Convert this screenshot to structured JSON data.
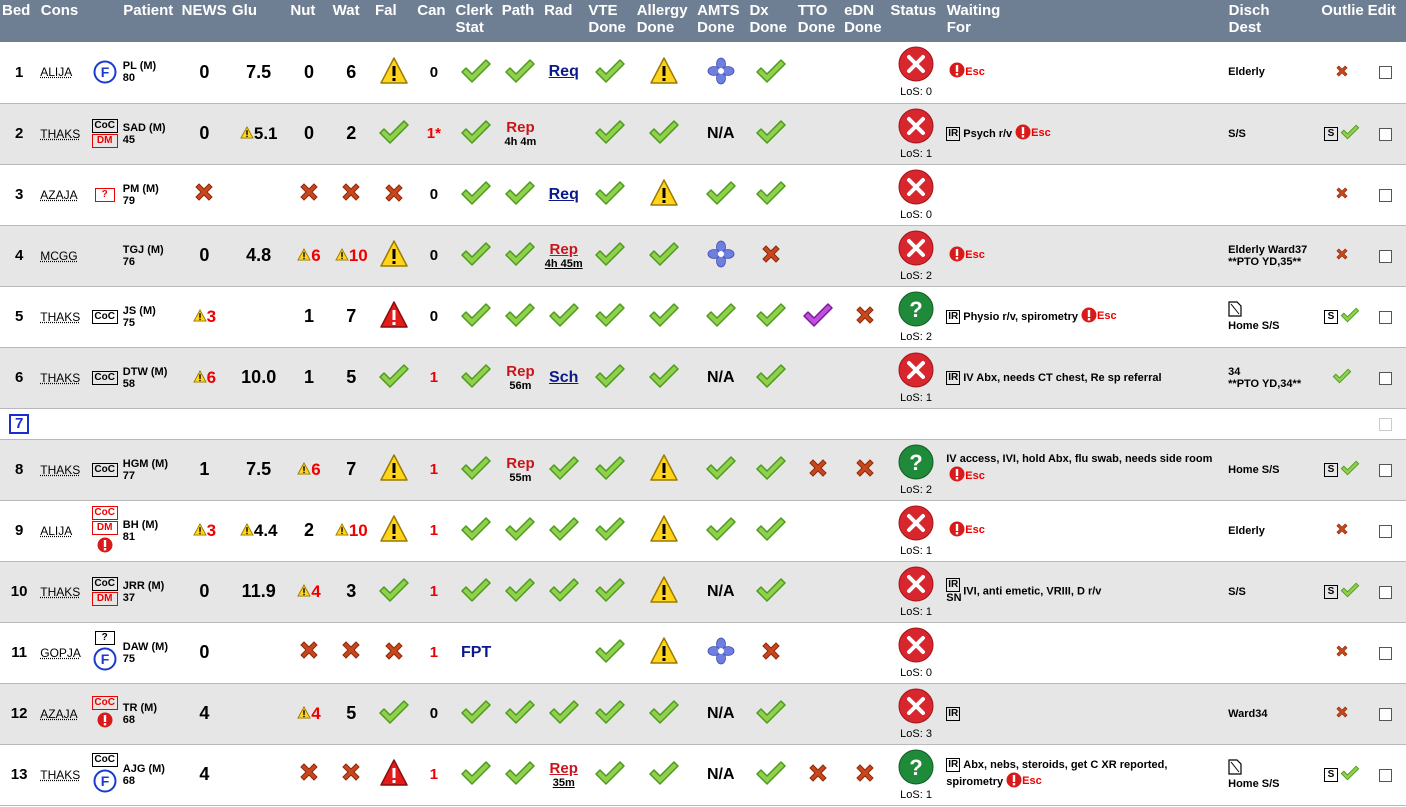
{
  "headers": {
    "bed": "Bed",
    "cons": "Cons",
    "patient": "Patient",
    "news": "NEWS",
    "glu": "Glu",
    "nut": "Nut",
    "wat": "Wat",
    "fal": "Fal",
    "can": "Can",
    "clerk_l1": "Clerk",
    "clerk_l2": "Stat",
    "path": "Path",
    "rad": "Rad",
    "vte_l1": "VTE",
    "vte_l2": "Done",
    "allergy_l1": "Allergy",
    "allergy_l2": "Done",
    "amts_l1": "AMTS",
    "amts_l2": "Done",
    "dx_l1": "Dx",
    "dx_l2": "Done",
    "tto_l1": "TTO",
    "tto_l2": "Done",
    "edn_l1": "eDN",
    "edn_l2": "Done",
    "status": "Status",
    "waiting_l1": "Waiting",
    "waiting_l2": "For",
    "disch_l1": "Disch",
    "disch_l2": "Dest",
    "outlier": "Outlie",
    "edit": "Edit"
  },
  "labels": {
    "esc": "Esc",
    "ir": "IR",
    "sn": "SN",
    "s": "S",
    "coc": "CoC",
    "dm": "DM",
    "q": "?",
    "f": "F",
    "na": "N/A"
  },
  "icons": {
    "ok": "check-icon",
    "no": "cross-icon",
    "warn": "warning-icon",
    "danger": "red-warning-icon",
    "flower": "flower-icon",
    "status_x": "status-x-icon",
    "status_q": "status-question-icon"
  },
  "rows": [
    {
      "bed": "1",
      "cons": "ALIJA",
      "tags": [
        "F"
      ],
      "patient": "PL (M)",
      "age": "80",
      "news": "0",
      "glu": "7.5",
      "nut": "0",
      "wat": "6",
      "fal": "warn",
      "can": "0",
      "clerk": "ok",
      "path": "ok",
      "rad": "Req",
      "vte": "ok",
      "allergy": "warn",
      "amts": "flower",
      "dx": "ok",
      "tto": "",
      "edn": "",
      "status": "x",
      "los": "LoS: 0",
      "waiting": {
        "ir": false,
        "text": "",
        "esc": true
      },
      "disch": "Elderly",
      "outlier": "no"
    },
    {
      "bed": "2",
      "cons": "THAKS",
      "tags": [
        "CoC",
        "DM"
      ],
      "patient": "SAD (M)",
      "age": "45",
      "news": "0",
      "glu": "5.1",
      "glu_warn": true,
      "nut": "0",
      "wat": "2",
      "fal": "ok",
      "can": "1*",
      "can_red": true,
      "clerk": "ok",
      "path_rep": "Rep",
      "path_sub": "4h 4m",
      "rad": "",
      "vte": "ok",
      "allergy": "ok",
      "amts": "N/A",
      "dx": "ok",
      "tto": "",
      "edn": "",
      "status": "x",
      "los": "LoS: 1",
      "waiting": {
        "ir": true,
        "text": "Psych r/v",
        "esc": true
      },
      "disch": "S/S",
      "outlier": "s-ok"
    },
    {
      "bed": "3",
      "cons": "AZAJA",
      "tags": [
        "?r"
      ],
      "patient": "PM (M)",
      "age": "79",
      "news": "no",
      "glu": "",
      "nut": "no",
      "wat": "no",
      "fal": "no",
      "can": "0",
      "clerk": "ok",
      "path": "ok",
      "rad": "Req",
      "vte": "ok",
      "allergy": "warn",
      "amts": "ok",
      "dx": "ok",
      "tto": "",
      "edn": "",
      "status": "x",
      "los": "LoS: 0",
      "waiting": {
        "ir": false,
        "text": "",
        "esc": false
      },
      "disch": "",
      "outlier": "no"
    },
    {
      "bed": "4",
      "cons": "MCGG",
      "tags": [],
      "patient": "TGJ (M)",
      "age": "76",
      "news": "0",
      "glu": "4.8",
      "nut": "6",
      "nut_warn": true,
      "wat": "10",
      "wat_warn": true,
      "fal": "warn",
      "can": "0",
      "clerk": "ok",
      "path": "ok",
      "rad_rep": "Rep",
      "rad_sub": "4h 45m",
      "vte": "ok",
      "allergy": "ok",
      "amts": "flower",
      "dx": "no",
      "tto": "",
      "edn": "",
      "status": "x",
      "los": "LoS: 2",
      "waiting": {
        "ir": false,
        "text": "",
        "esc": true
      },
      "disch": "Elderly Ward37",
      "disch2": "**PTO YD,35**",
      "outlier": "no"
    },
    {
      "bed": "5",
      "cons": "THAKS",
      "tags": [
        "CoC"
      ],
      "patient": "JS (M)",
      "age": "75",
      "news": "3",
      "news_warn": true,
      "glu": "",
      "nut": "1",
      "wat": "7",
      "fal": "danger",
      "can": "0",
      "clerk": "ok",
      "path": "ok",
      "rad": "ok",
      "vte": "ok",
      "allergy": "ok",
      "amts": "ok",
      "dx": "ok",
      "tto": "purple",
      "edn": "no",
      "status": "q",
      "los": "LoS: 2",
      "waiting": {
        "ir": true,
        "text": "Physio r/v, spirometry",
        "esc": true
      },
      "disch": "Home S/S",
      "disch_doc": true,
      "outlier": "s-ok"
    },
    {
      "bed": "6",
      "cons": "THAKS",
      "tags": [
        "CoC"
      ],
      "patient": "DTW (M)",
      "age": "58",
      "news": "6",
      "news_warn": true,
      "glu": "10.0",
      "nut": "1",
      "wat": "5",
      "fal": "ok",
      "can": "1",
      "can_red": true,
      "clerk": "ok",
      "path_rep": "Rep",
      "path_sub": "56m",
      "rad": "Sch",
      "vte": "ok",
      "allergy": "ok",
      "amts": "N/A",
      "dx": "ok",
      "tto": "",
      "edn": "",
      "status": "x",
      "los": "LoS: 1",
      "waiting": {
        "ir": true,
        "text": "IV Abx, needs CT chest, Re sp referral",
        "esc": false
      },
      "disch": "34",
      "disch2": "**PTO YD,34**",
      "outlier": "ok"
    },
    {
      "bed": "7",
      "empty": true
    },
    {
      "bed": "8",
      "cons": "THAKS",
      "tags": [
        "CoC"
      ],
      "patient": "HGM (M)",
      "age": "77",
      "news": "1",
      "glu": "7.5",
      "nut": "6",
      "nut_warn": true,
      "wat": "7",
      "fal": "warn",
      "can": "1",
      "can_red": true,
      "clerk": "ok",
      "path_rep": "Rep",
      "path_sub": "55m",
      "rad": "ok",
      "vte": "ok",
      "allergy": "warn",
      "amts": "ok",
      "dx": "ok",
      "tto": "no",
      "edn": "no",
      "status": "q",
      "los": "LoS: 2",
      "waiting": {
        "ir": false,
        "text": "IV access, IVI, hold Abx, flu swab, needs side room",
        "esc": true
      },
      "disch": "Home S/S",
      "outlier": "s-ok"
    },
    {
      "bed": "9",
      "cons": "ALIJA",
      "tags": [
        "CoCr",
        "DM",
        "!"
      ],
      "patient": "BH (M)",
      "age": "81",
      "news": "3",
      "news_warn": true,
      "glu": "4.4",
      "glu_warn": true,
      "nut": "2",
      "wat": "10",
      "wat_warn": true,
      "fal": "warn",
      "can": "1",
      "can_red": true,
      "clerk": "ok",
      "path": "ok",
      "rad": "ok",
      "vte": "ok",
      "allergy": "warn",
      "amts": "ok",
      "dx": "ok",
      "tto": "",
      "edn": "",
      "status": "x",
      "los": "LoS: 1",
      "waiting": {
        "ir": false,
        "text": "",
        "esc": true
      },
      "disch": "Elderly",
      "outlier": "no"
    },
    {
      "bed": "10",
      "cons": "THAKS",
      "tags": [
        "CoC",
        "DM"
      ],
      "patient": "JRR (M)",
      "age": "37",
      "news": "0",
      "glu": "11.9",
      "nut": "4",
      "nut_warn": true,
      "wat": "3",
      "fal": "ok",
      "can": "1",
      "can_red": true,
      "clerk": "ok",
      "path": "ok",
      "rad": "ok",
      "vte": "ok",
      "allergy": "warn",
      "amts": "N/A",
      "dx": "ok",
      "tto": "",
      "edn": "",
      "status": "x",
      "los": "LoS: 1",
      "waiting": {
        "ir": true,
        "sn": true,
        "text": "IVI, anti emetic, VRIII, D r/v",
        "esc": false
      },
      "disch": "S/S",
      "outlier": "s-ok"
    },
    {
      "bed": "11",
      "cons": "GOPJA",
      "tags": [
        "?",
        "F"
      ],
      "patient": "DAW (M)",
      "age": "75",
      "news": "0",
      "glu": "",
      "nut": "no",
      "wat": "no",
      "fal": "no",
      "can": "1",
      "can_red": true,
      "clerk_text": "FPT",
      "path": "",
      "rad": "",
      "vte": "ok",
      "allergy": "warn",
      "amts": "flower",
      "dx": "no",
      "tto": "",
      "edn": "",
      "status": "x",
      "los": "LoS: 0",
      "waiting": {
        "ir": false,
        "text": "",
        "esc": false
      },
      "disch": "",
      "outlier": "no"
    },
    {
      "bed": "12",
      "cons": "AZAJA",
      "tags": [
        "CoCr",
        "!"
      ],
      "patient": "TR (M)",
      "age": "68",
      "news": "4",
      "glu": "",
      "nut": "4",
      "nut_warn": true,
      "wat": "5",
      "fal": "ok",
      "can": "0",
      "clerk": "ok",
      "path": "ok",
      "rad": "ok",
      "vte": "ok",
      "allergy": "ok",
      "amts": "N/A",
      "dx": "ok",
      "tto": "",
      "edn": "",
      "status": "x",
      "los": "LoS: 3",
      "waiting": {
        "ir": true,
        "text": "",
        "esc": false
      },
      "disch": "Ward34",
      "outlier": "no"
    },
    {
      "bed": "13",
      "cons": "THAKS",
      "tags": [
        "CoC",
        "F"
      ],
      "patient": "AJG (M)",
      "age": "68",
      "news": "4",
      "glu": "",
      "nut": "no",
      "wat": "no",
      "fal": "danger",
      "can": "1",
      "can_red": true,
      "clerk": "ok",
      "path": "ok",
      "rad_rep": "Rep",
      "rad_sub": "35m",
      "vte": "ok",
      "allergy": "ok",
      "amts": "N/A",
      "dx": "ok",
      "tto": "no",
      "edn": "no",
      "status": "q",
      "los": "LoS: 1",
      "waiting": {
        "ir": true,
        "text": "Abx, nebs, steroids, get C XR reported, spirometry",
        "esc": true
      },
      "disch": "Home S/S",
      "disch_doc": true,
      "outlier": "s-ok"
    }
  ]
}
